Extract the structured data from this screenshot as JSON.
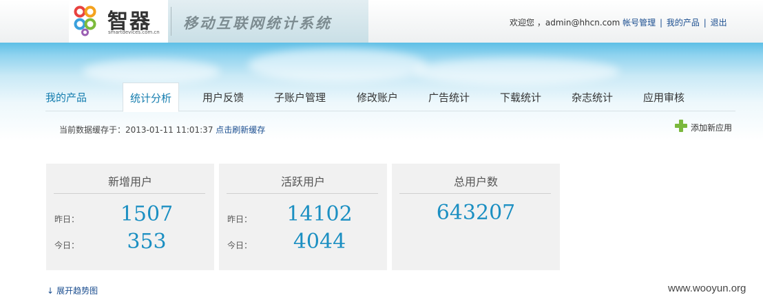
{
  "header": {
    "logo_cn": "智器",
    "logo_en": "smartdevices.com.cn",
    "system_title": "移动互联网统计系统",
    "welcome": "欢迎您",
    "username": "，admin@hhcn.com",
    "links": [
      "帐号管理",
      "我的产品",
      "退出"
    ],
    "separator": "|"
  },
  "nav": {
    "tabs": [
      "我的产品",
      "统计分析",
      "用户反馈",
      "子账户管理",
      "修改账户",
      "广告统计",
      "下载统计",
      "杂志统计",
      "应用审核"
    ],
    "active_index": 1
  },
  "cache": {
    "prefix": "当前数据缓存于：2013-01-11 11:01:37",
    "refresh_link": "点击刷新缓存"
  },
  "add_app": {
    "label": "添加新应用",
    "icon": "plus-icon"
  },
  "cards": [
    {
      "title": "新增用户",
      "yesterday_label": "昨日：",
      "yesterday_value": "1507",
      "today_label": "今日：",
      "today_value": "353"
    },
    {
      "title": "活跃用户",
      "yesterday_label": "昨日：",
      "yesterday_value": "14102",
      "today_label": "今日：",
      "today_value": "4044"
    },
    {
      "title": "总用户数",
      "total_value": "643207"
    }
  ],
  "expand": {
    "arrow": "↓",
    "label": "展开趋势图"
  },
  "watermark": "www.wooyun.org",
  "colors": {
    "accent": "#1b8fc2",
    "link": "#1a4d8f",
    "add_icon": "#7ab83d",
    "card_bg": "#f1f1f1"
  }
}
